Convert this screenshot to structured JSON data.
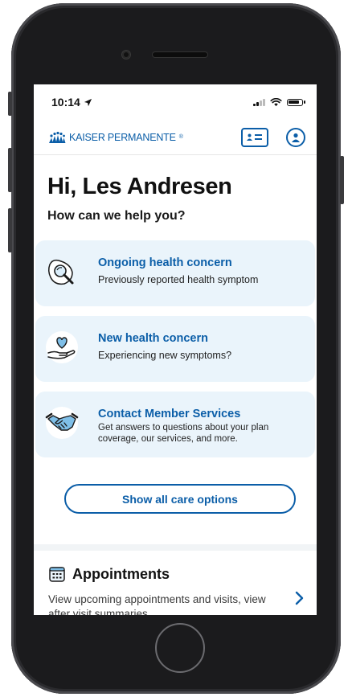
{
  "status_bar": {
    "time": "10:14"
  },
  "app_bar": {
    "brand_name": "KAISER PERMANENTE",
    "brand_mark": "®"
  },
  "home": {
    "greeting": "Hi, Les Andresen",
    "subheading": "How can we help you?",
    "cards": [
      {
        "title": "Ongoing health concern",
        "description": "Previously reported health symptom",
        "icon": "magnifier-icon"
      },
      {
        "title": "New health concern",
        "description": "Experiencing new symptoms?",
        "icon": "heart-hand-icon"
      },
      {
        "title": "Contact Member Services",
        "description": "Get answers to questions about your plan coverage, our services, and more.",
        "icon": "handshake-icon"
      }
    ],
    "show_all_label": "Show all care options",
    "appointments": {
      "title": "Appointments",
      "description": "View upcoming appointments and visits, view after visit summaries"
    }
  },
  "colors": {
    "brand": "#0b5ea8",
    "card_bg": "#eaf4fb",
    "text": "#111111"
  }
}
